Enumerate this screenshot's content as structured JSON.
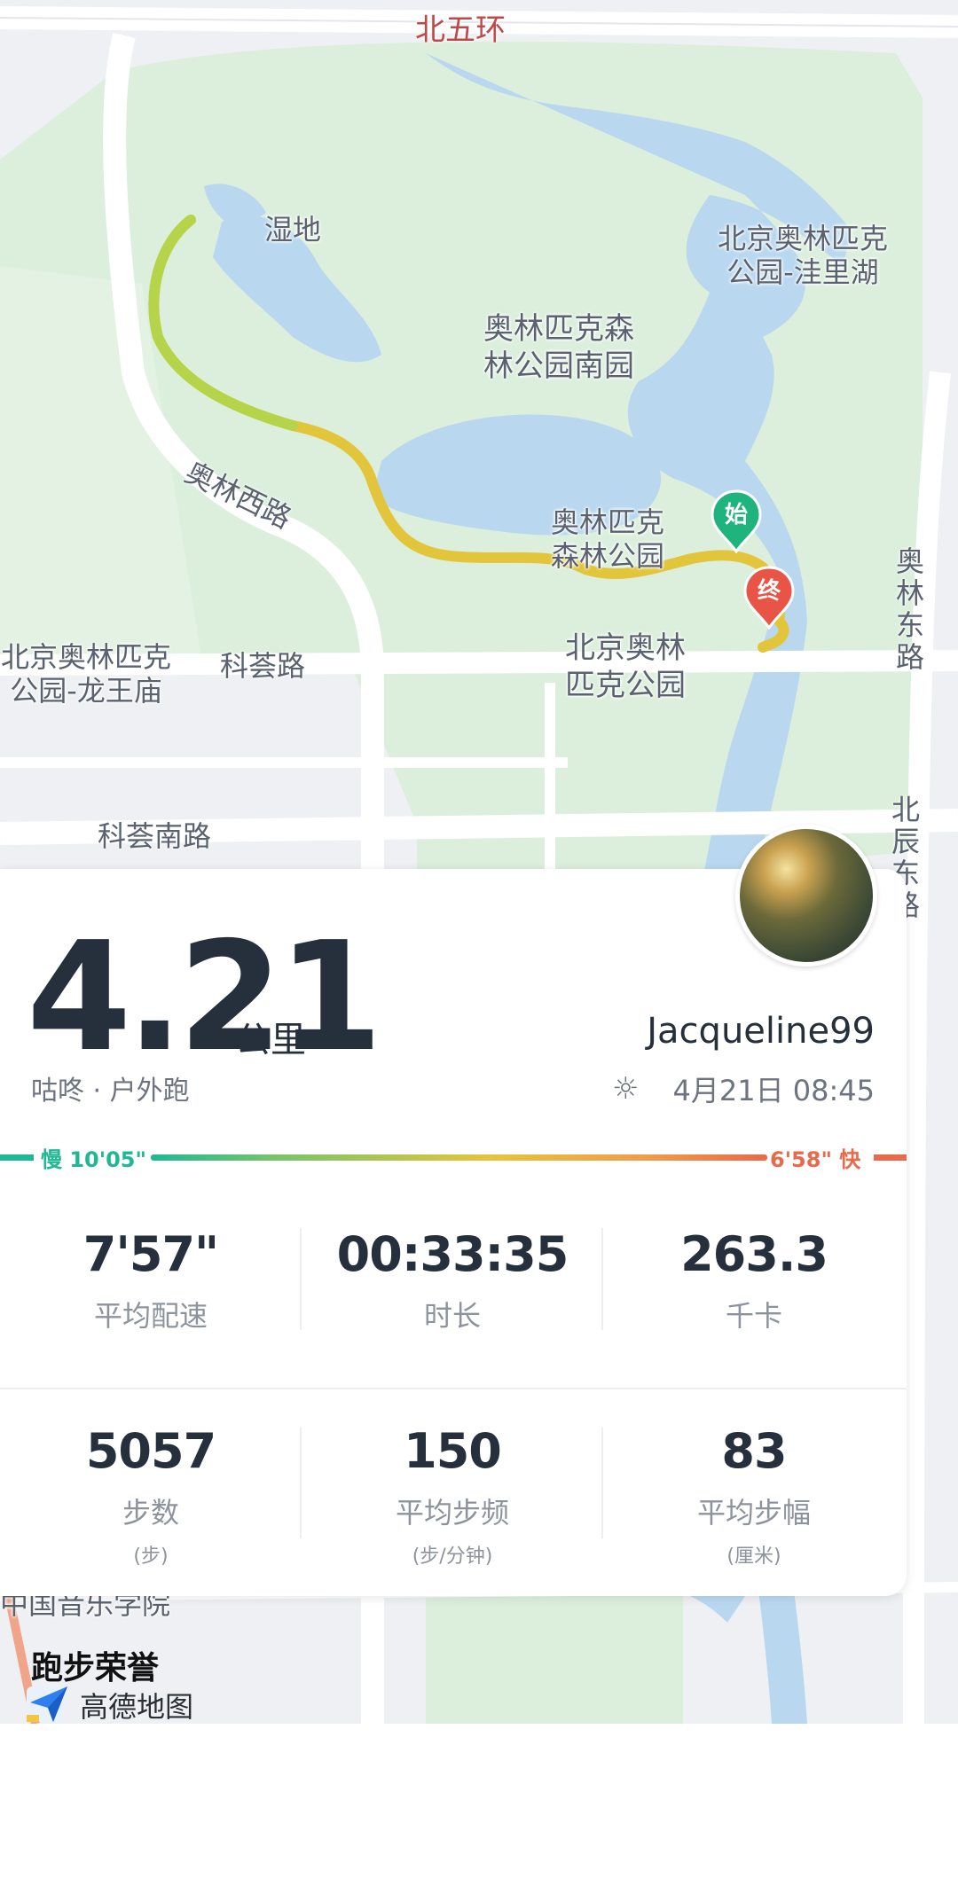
{
  "map": {
    "ring_road": "北五环",
    "labels": {
      "wetland": "湿地",
      "lake_north": "北京奥林匹克\n公园-洼里湖",
      "forest_park_south": "奥林匹克森\n林公园南园",
      "aolin_west_road": "奥林西路",
      "forest_park": "奥林匹克\n森林公园",
      "olympic_park": "北京奥林\n匹克公园",
      "dragon_temple": "北京奥林匹克\n公园-龙王庙",
      "kehui_road": "科荟路",
      "kehui_south_road": "科荟南路",
      "aolin_east_road": "奥\n林\n东\n路",
      "beichen_east_road": "北\n辰\n东\n路",
      "music_college": "中国音乐学院"
    },
    "start_marker": "始",
    "end_marker": "终"
  },
  "run": {
    "distance": "4.21",
    "distance_unit": "公里",
    "source": "咕咚 · 户外跑",
    "username": "Jacqueline99",
    "weather_icon": "sun-icon",
    "date_time": "4月21日 08:45",
    "pace_slow_label": "慢 10'05\"",
    "pace_fast_label": "6'58\" 快"
  },
  "stats_row1": [
    {
      "value": "7'57\"",
      "label": "平均配速"
    },
    {
      "value": "00:33:35",
      "label": "时长"
    },
    {
      "value": "263.3",
      "label": "千卡"
    }
  ],
  "stats_row2": [
    {
      "value": "5057",
      "label": "步数",
      "unit": "(步)"
    },
    {
      "value": "150",
      "label": "平均步频",
      "unit": "(步/分钟)"
    },
    {
      "value": "83",
      "label": "平均步幅",
      "unit": "(厘米)"
    }
  ],
  "footer": {
    "honor": "跑步荣誉",
    "brand": "高德地图",
    "brand_icon": "amap-logo-icon"
  },
  "colors": {
    "slow": "#20b894",
    "fast": "#e86a4b",
    "route": "#e2c53a",
    "text_dark": "#26303d"
  }
}
